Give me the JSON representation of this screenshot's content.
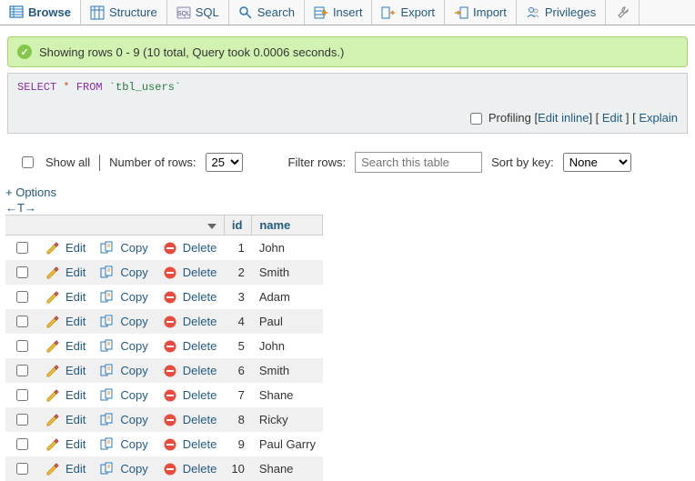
{
  "tabs": {
    "browse": "Browse",
    "structure": "Structure",
    "sql": "SQL",
    "search": "Search",
    "insert": "Insert",
    "export": "Export",
    "import": "Import",
    "privileges": "Privileges"
  },
  "notice": {
    "text": "Showing rows 0 - 9 (10 total, Query took 0.0006 seconds.)"
  },
  "sql": {
    "select": "SELECT",
    "star": "*",
    "from": "FROM",
    "table_ref": "`tbl_users`"
  },
  "sql_actions": {
    "profiling": "Profiling",
    "edit_inline": "Edit inline",
    "edit": "Edit",
    "explain": "Explain"
  },
  "controls": {
    "show_all": "Show all",
    "num_rows_label": "Number of rows:",
    "num_rows_value": "25",
    "filter_label": "Filter rows:",
    "filter_placeholder": "Search this table",
    "sort_label": "Sort by key:",
    "sort_value": "None"
  },
  "options_link": "+ Options",
  "sort_icons": "←T→",
  "columns": {
    "id": "id",
    "name": "name"
  },
  "row_actions": {
    "edit": "Edit",
    "copy": "Copy",
    "delete": "Delete"
  },
  "rows": [
    {
      "id": "1",
      "name": "John"
    },
    {
      "id": "2",
      "name": "Smith"
    },
    {
      "id": "3",
      "name": "Adam"
    },
    {
      "id": "4",
      "name": "Paul"
    },
    {
      "id": "5",
      "name": "John"
    },
    {
      "id": "6",
      "name": "Smith"
    },
    {
      "id": "7",
      "name": "Shane"
    },
    {
      "id": "8",
      "name": "Ricky"
    },
    {
      "id": "9",
      "name": "Paul Garry"
    },
    {
      "id": "10",
      "name": "Shane"
    }
  ]
}
